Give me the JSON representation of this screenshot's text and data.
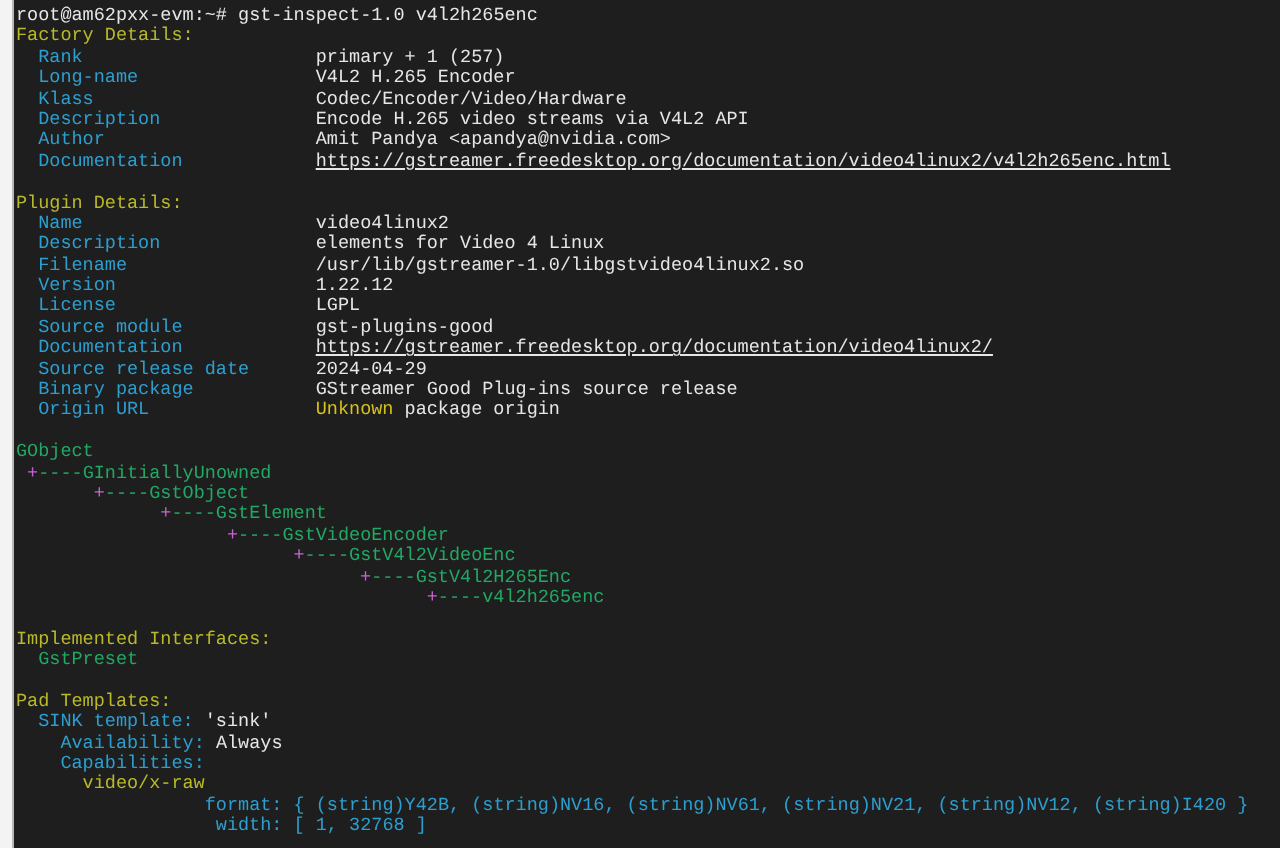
{
  "prompt": "root@am62pxx-evm:~# gst-inspect-1.0 v4l2h265enc",
  "factory_details": {
    "title": "Factory Details:",
    "rows": [
      {
        "key": "Rank",
        "value": "primary + 1 (257)",
        "kind": "text"
      },
      {
        "key": "Long-name",
        "value": "V4L2 H.265 Encoder",
        "kind": "text"
      },
      {
        "key": "Klass",
        "value": "Codec/Encoder/Video/Hardware",
        "kind": "text"
      },
      {
        "key": "Description",
        "value": "Encode H.265 video streams via V4L2 API",
        "kind": "text"
      },
      {
        "key": "Author",
        "value": "Amit Pandya <apandya@nvidia.com>",
        "kind": "text"
      },
      {
        "key": "Documentation",
        "value": "https://gstreamer.freedesktop.org/documentation/video4linux2/v4l2h265enc.html",
        "kind": "link"
      }
    ]
  },
  "plugin_details": {
    "title": "Plugin Details:",
    "rows": [
      {
        "key": "Name",
        "value": "video4linux2",
        "kind": "text"
      },
      {
        "key": "Description",
        "value": "elements for Video 4 Linux",
        "kind": "text"
      },
      {
        "key": "Filename",
        "value": "/usr/lib/gstreamer-1.0/libgstvideo4linux2.so",
        "kind": "text"
      },
      {
        "key": "Version",
        "value": "1.22.12",
        "kind": "text"
      },
      {
        "key": "License",
        "value": "LGPL",
        "kind": "text"
      },
      {
        "key": "Source module",
        "value": "gst-plugins-good",
        "kind": "text"
      },
      {
        "key": "Documentation",
        "value": "https://gstreamer.freedesktop.org/documentation/video4linux2/",
        "kind": "link"
      },
      {
        "key": "Source release date",
        "value": "2024-04-29",
        "kind": "text"
      },
      {
        "key": "Binary package",
        "value": "GStreamer Good Plug-ins source release",
        "kind": "text"
      },
      {
        "key": "Origin URL",
        "value": "Unknown",
        "suffix": "package origin",
        "kind": "warning"
      }
    ]
  },
  "hierarchy": {
    "name": "GObject",
    "children": [
      {
        "mark": "+",
        "dashes": "----",
        "name": "GInitiallyUnowned",
        "children": [
          {
            "mark": "+",
            "dashes": "----",
            "name": "GstObject",
            "children": [
              {
                "mark": "+",
                "dashes": "----",
                "name": "GstElement",
                "children": [
                  {
                    "mark": "+",
                    "dashes": "----",
                    "name": "GstVideoEncoder",
                    "children": [
                      {
                        "mark": "+",
                        "dashes": "----",
                        "name": "GstV4l2VideoEnc",
                        "children": [
                          {
                            "mark": "+",
                            "dashes": "----",
                            "name": "GstV4l2H265Enc",
                            "children": [
                              {
                                "mark": "+",
                                "dashes": "----",
                                "name": "v4l2h265enc"
                              }
                            ]
                          }
                        ]
                      }
                    ]
                  }
                ]
              }
            ]
          }
        ]
      }
    ]
  },
  "interfaces": {
    "title": "Implemented Interfaces:",
    "items": [
      "GstPreset"
    ]
  },
  "pad_templates": {
    "title": "Pad Templates:",
    "templates": [
      {
        "label": "SINK template:",
        "name": "'sink'",
        "availability_label": "Availability:",
        "availability": "Always",
        "capabilities_label": "Capabilities:",
        "caps": [
          {
            "media": "video/x-raw",
            "fields": [
              {
                "key": "format:",
                "value": "{ (string)Y42B, (string)NV16, (string)NV61, (string)NV21, (string)NV12, (string)I420 }"
              },
              {
                "key": "width:",
                "value": "[ 1, 32768 ]"
              }
            ]
          }
        ]
      }
    ]
  }
}
